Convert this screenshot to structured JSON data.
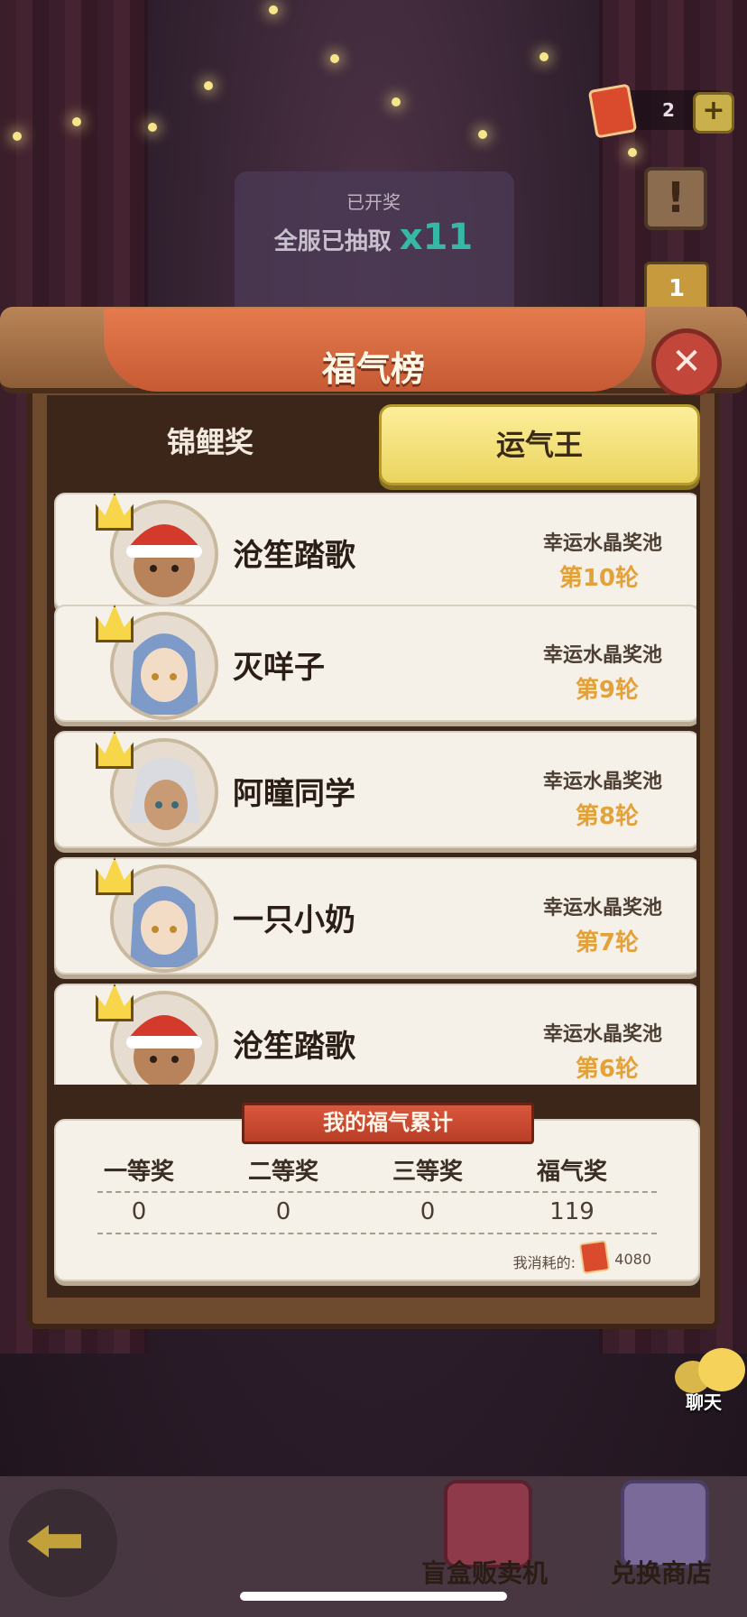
{
  "header": {
    "ticket_count": "2",
    "plus_label": "+",
    "notice_label": "!",
    "rank_label": "1",
    "open_status": "已开奖",
    "drawn_text": "全服已抽取",
    "drawn_multiplier": "x11"
  },
  "panel": {
    "title": "福气榜",
    "close_label": "✕",
    "tabs": [
      {
        "label": "锦鲤奖",
        "active": false
      },
      {
        "label": "运气王",
        "active": true
      }
    ],
    "rows": [
      {
        "name": "沧笙踏歌",
        "pool": "幸运水晶奖池",
        "round": "第10轮",
        "avatar": "red-hat-character"
      },
      {
        "name": "灭咩子",
        "pool": "幸运水晶奖池",
        "round": "第9轮",
        "avatar": "blue-hair-character"
      },
      {
        "name": "阿瞳同学",
        "pool": "幸运水晶奖池",
        "round": "第8轮",
        "avatar": "white-hair-character"
      },
      {
        "name": "一只小奶",
        "pool": "幸运水晶奖池",
        "round": "第7轮",
        "avatar": "blue-hair-character"
      },
      {
        "name": "沧笙踏歌",
        "pool": "幸运水晶奖池",
        "round": "第6轮",
        "avatar": "red-hat-character"
      }
    ]
  },
  "summary": {
    "title": "我的福气累计",
    "columns": [
      "一等奖",
      "二等奖",
      "三等奖",
      "福气奖"
    ],
    "values": [
      "0",
      "0",
      "0",
      "119"
    ],
    "spent_label": "我消耗的:",
    "spent_value": "4080"
  },
  "chat": {
    "label": "聊天"
  },
  "bottom_nav": {
    "blind_box": "盲盒贩卖机",
    "exchange": "兑换商店"
  },
  "colors": {
    "accent_yellow": "#f2de6e",
    "round_orange": "#e3a13a",
    "banner_red": "#c65a34"
  }
}
